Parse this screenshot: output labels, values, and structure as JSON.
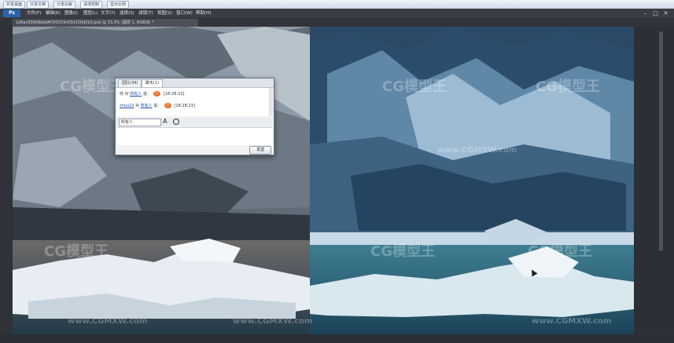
{
  "toolbar": {
    "buttons": [
      "共享桌面",
      "分享文档",
      "分享白板",
      "请求控制",
      "显示比例"
    ]
  },
  "menu": {
    "app_logo": "Ps",
    "items": [
      "文件(F)",
      "编辑(E)",
      "图像(I)",
      "图层(L)",
      "文字(Y)",
      "选择(S)",
      "滤镜(T)",
      "视图(V)",
      "窗口(W)",
      "帮助(H)"
    ]
  },
  "window_controls": [
    "–",
    "□",
    "✕"
  ],
  "document": {
    "tab_title": "1d6ac638d9ebd4f1f0159c05d150d2b3.psd @ 33.3% (图层 1, RGB/8) *"
  },
  "watermarks": [
    "CG模型王",
    "www.CGMXW.com"
  ],
  "chat": {
    "tabs": [
      "团队(34)",
      "聊天(1)"
    ],
    "messages": [
      {
        "sender": "你",
        "verb": "对",
        "target": "所有人",
        "text": "说：",
        "time": "[18:28:22]"
      },
      {
        "sender": "zhou10",
        "verb": "对",
        "target": "所有人",
        "text": "说：",
        "time": "[18:28:23]"
      }
    ],
    "recipient": "所有人",
    "font_button": "A",
    "send_label": "发送"
  },
  "colors": {
    "accent": "#2a64a7",
    "menubar": "#3a3d44",
    "glacier_left": "#6e7b86",
    "glacier_right": "#1f3d5a"
  }
}
